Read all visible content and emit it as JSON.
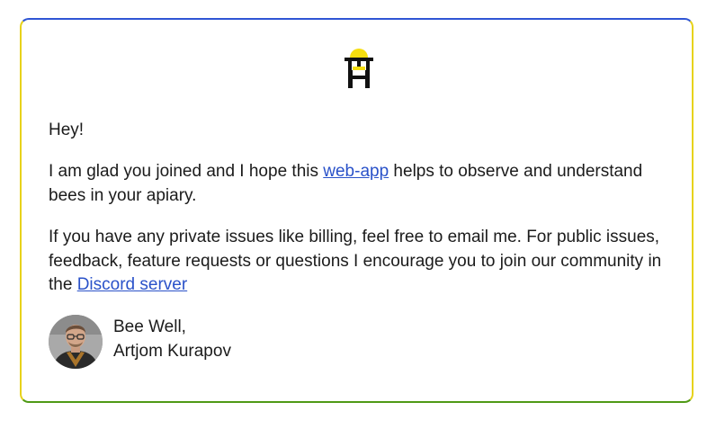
{
  "message": {
    "greeting": "Hey!",
    "para1_before": "I am glad you joined and I hope this ",
    "para1_link": "web-app",
    "para1_after": " helps to observe and understand bees in your apiary.",
    "para2_before": "If you have any private issues like billing, feel free to email me. For public issues, feedback, feature requests or questions I encourage you to join our community in the ",
    "para2_link": "Discord server"
  },
  "signature": {
    "line1": "Bee Well,",
    "line2": "Artjom Kurapov"
  },
  "icons": {
    "logo": "beehive-logo-icon",
    "avatar": "author-avatar"
  },
  "colors": {
    "border_top": "#2f55d4",
    "border_sides": "#e7d21a",
    "border_bottom": "#4f9a16",
    "link": "#2a52c9",
    "logo_yellow": "#f6de0f"
  }
}
